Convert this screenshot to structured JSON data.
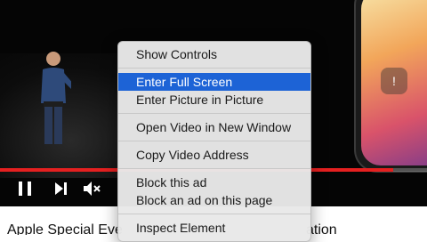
{
  "video": {
    "progress_fraction": 0.92,
    "phone_glyph": "!"
  },
  "controls": {
    "play_icon": "pause-icon",
    "next_icon": "skip-next-icon",
    "mute_icon": "volume-muted-icon"
  },
  "page": {
    "title_start": "Apple Special Eve",
    "title_end": "ation"
  },
  "context_menu": {
    "show_controls": "Show Controls",
    "enter_full_screen": "Enter Full Screen",
    "enter_pip": "Enter Picture in Picture",
    "open_new_window": "Open Video in New Window",
    "copy_address": "Copy Video Address",
    "block_ad": "Block this ad",
    "block_ad_page": "Block an ad on this page",
    "inspect": "Inspect Element"
  },
  "colors": {
    "highlight": "#1d63d6",
    "progress": "#e52020"
  }
}
